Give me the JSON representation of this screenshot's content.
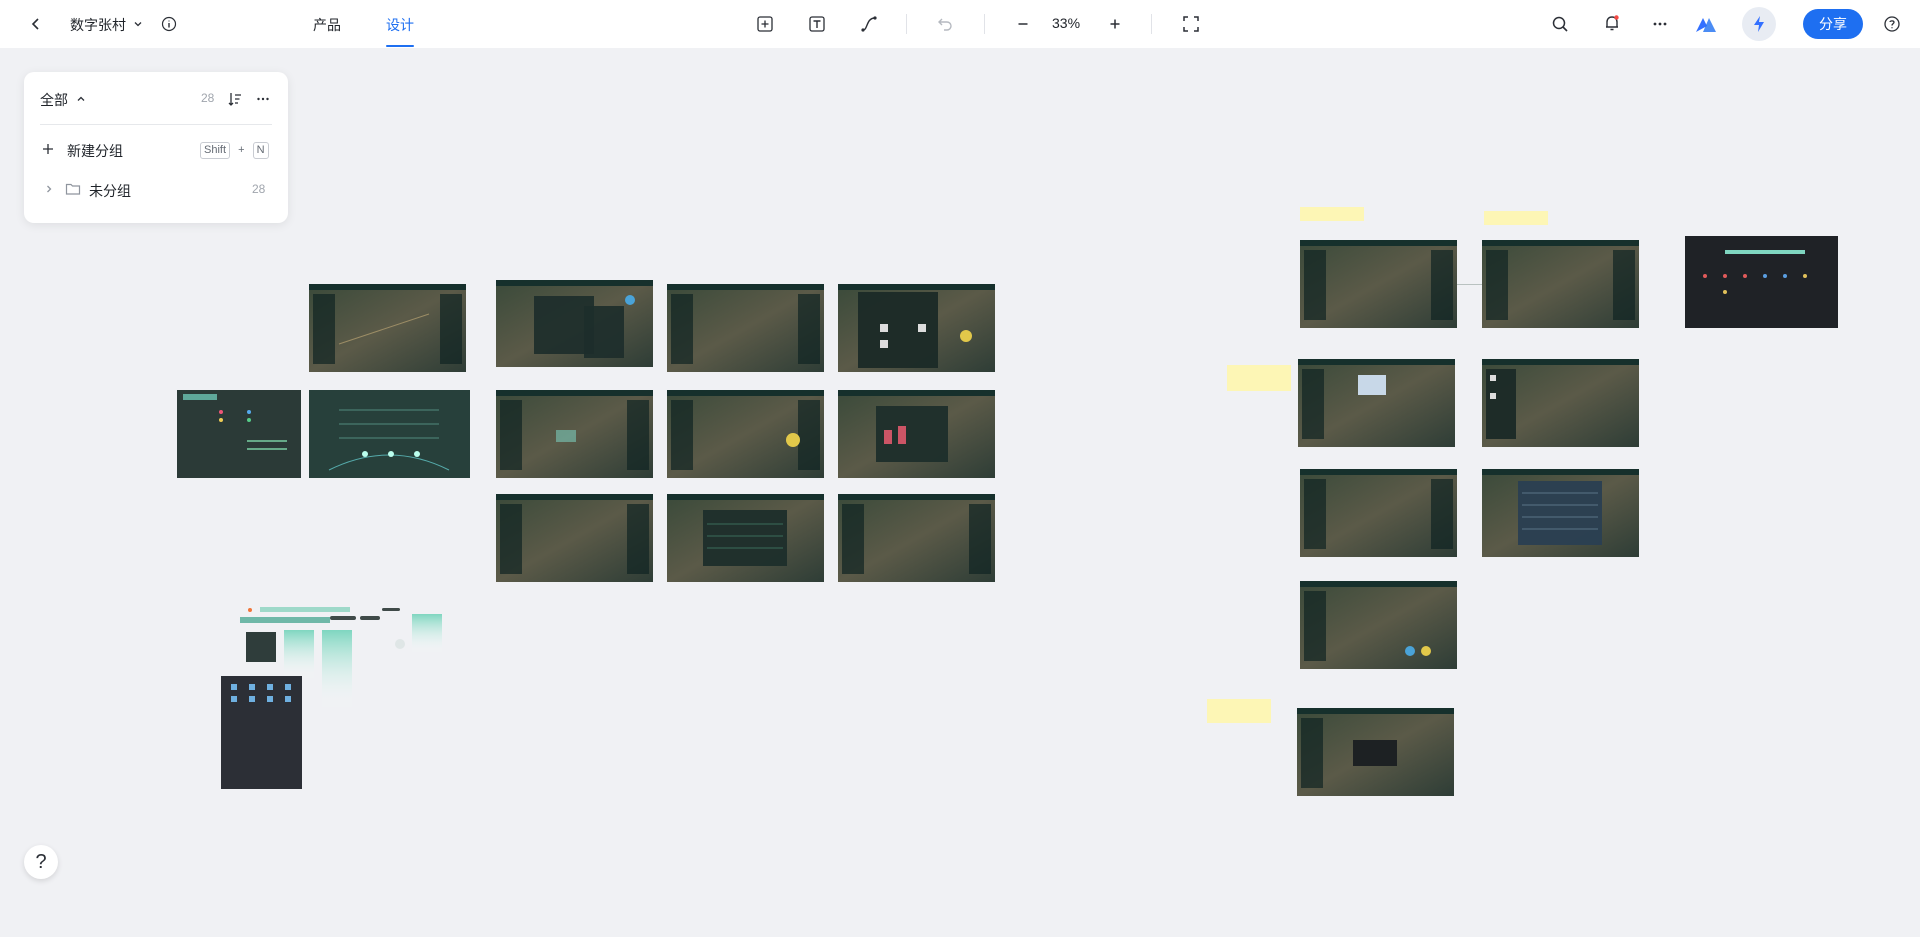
{
  "header": {
    "doc_title": "数字张村",
    "tabs": [
      {
        "label": "产品",
        "active": false
      },
      {
        "label": "设计",
        "active": true
      }
    ],
    "zoom": "33%",
    "share_label": "分享"
  },
  "panel": {
    "title": "全部",
    "count": "28",
    "new_group_label": "新建分组",
    "shortcut": [
      "Shift",
      "+",
      "N"
    ],
    "group_name": "未分组",
    "group_count": "28"
  },
  "colors": {
    "accent": "#1e6ff1",
    "canvas_bg": "#f0f1f4",
    "artboard_dark": "#1e2b2a",
    "sticky_note": "#fdf6b5"
  },
  "icons": [
    "back-icon",
    "chevron-down-icon",
    "info-icon",
    "add-frame-icon",
    "text-tool-icon",
    "connector-icon",
    "undo-icon",
    "zoom-out-icon",
    "zoom-in-icon",
    "fullscreen-icon",
    "search-icon",
    "bell-icon",
    "more-icon",
    "logo-icon",
    "lightning-icon",
    "help-icon",
    "sort-icon",
    "plus-icon",
    "folder-icon",
    "chevron-right-icon"
  ]
}
